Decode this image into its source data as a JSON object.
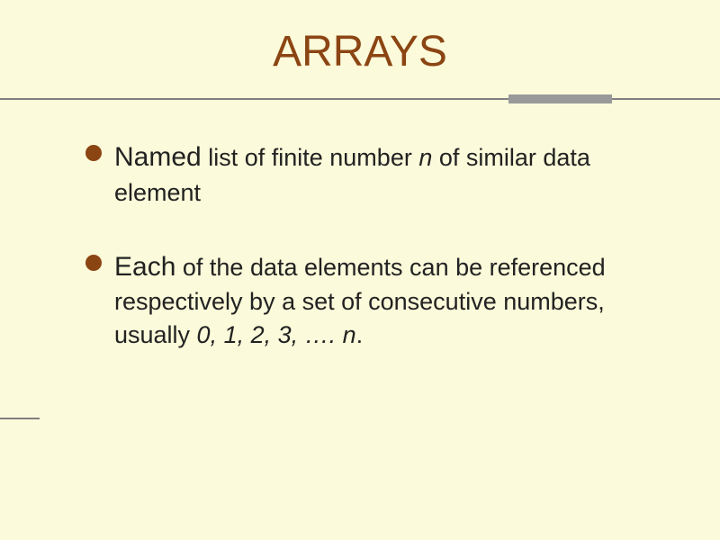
{
  "title": "ARRAYS",
  "bullets": [
    {
      "first": "Named",
      "rest1": " list of finite number ",
      "em1": "n",
      "rest2": " of similar data element"
    },
    {
      "first": "Each",
      "rest1": " of the data elements can be referenced respectively by a set of consecutive numbers, usually ",
      "em1": "0, 1, 2, 3, …. n",
      "rest2": "."
    }
  ]
}
